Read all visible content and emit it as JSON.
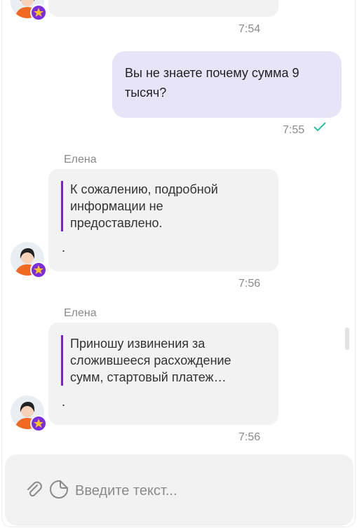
{
  "messages": [
    {
      "type": "incoming-partial",
      "time": "7:54"
    },
    {
      "type": "outgoing",
      "text_line1": "Вы не знаете почему сумма 9",
      "text_line2": "тысяч?",
      "time": "7:55",
      "status_icon": "double-check-icon"
    },
    {
      "type": "incoming",
      "sender": "Елена",
      "quote_lines": [
        "К сожалению, подробной",
        "информации не",
        "предоставлено."
      ],
      "dot": ".",
      "time": "7:56"
    },
    {
      "type": "incoming",
      "sender": "Елена",
      "quote_lines": [
        "Приношу извинения за",
        "сложившееся расхождение",
        "сумм, стартовый платеж…"
      ],
      "dot": ".",
      "time": "7:56"
    }
  ],
  "composer": {
    "placeholder": "Введите текст...",
    "attach_icon": "paperclip-icon",
    "sticker_icon": "sticker-icon"
  },
  "colors": {
    "accent": "#7b2ee0",
    "quote_bar": "#7a1fd6",
    "outgoing_bubble": "#e8e4f8",
    "incoming_bubble": "#f2f2f2",
    "check": "#2bbfa4"
  }
}
